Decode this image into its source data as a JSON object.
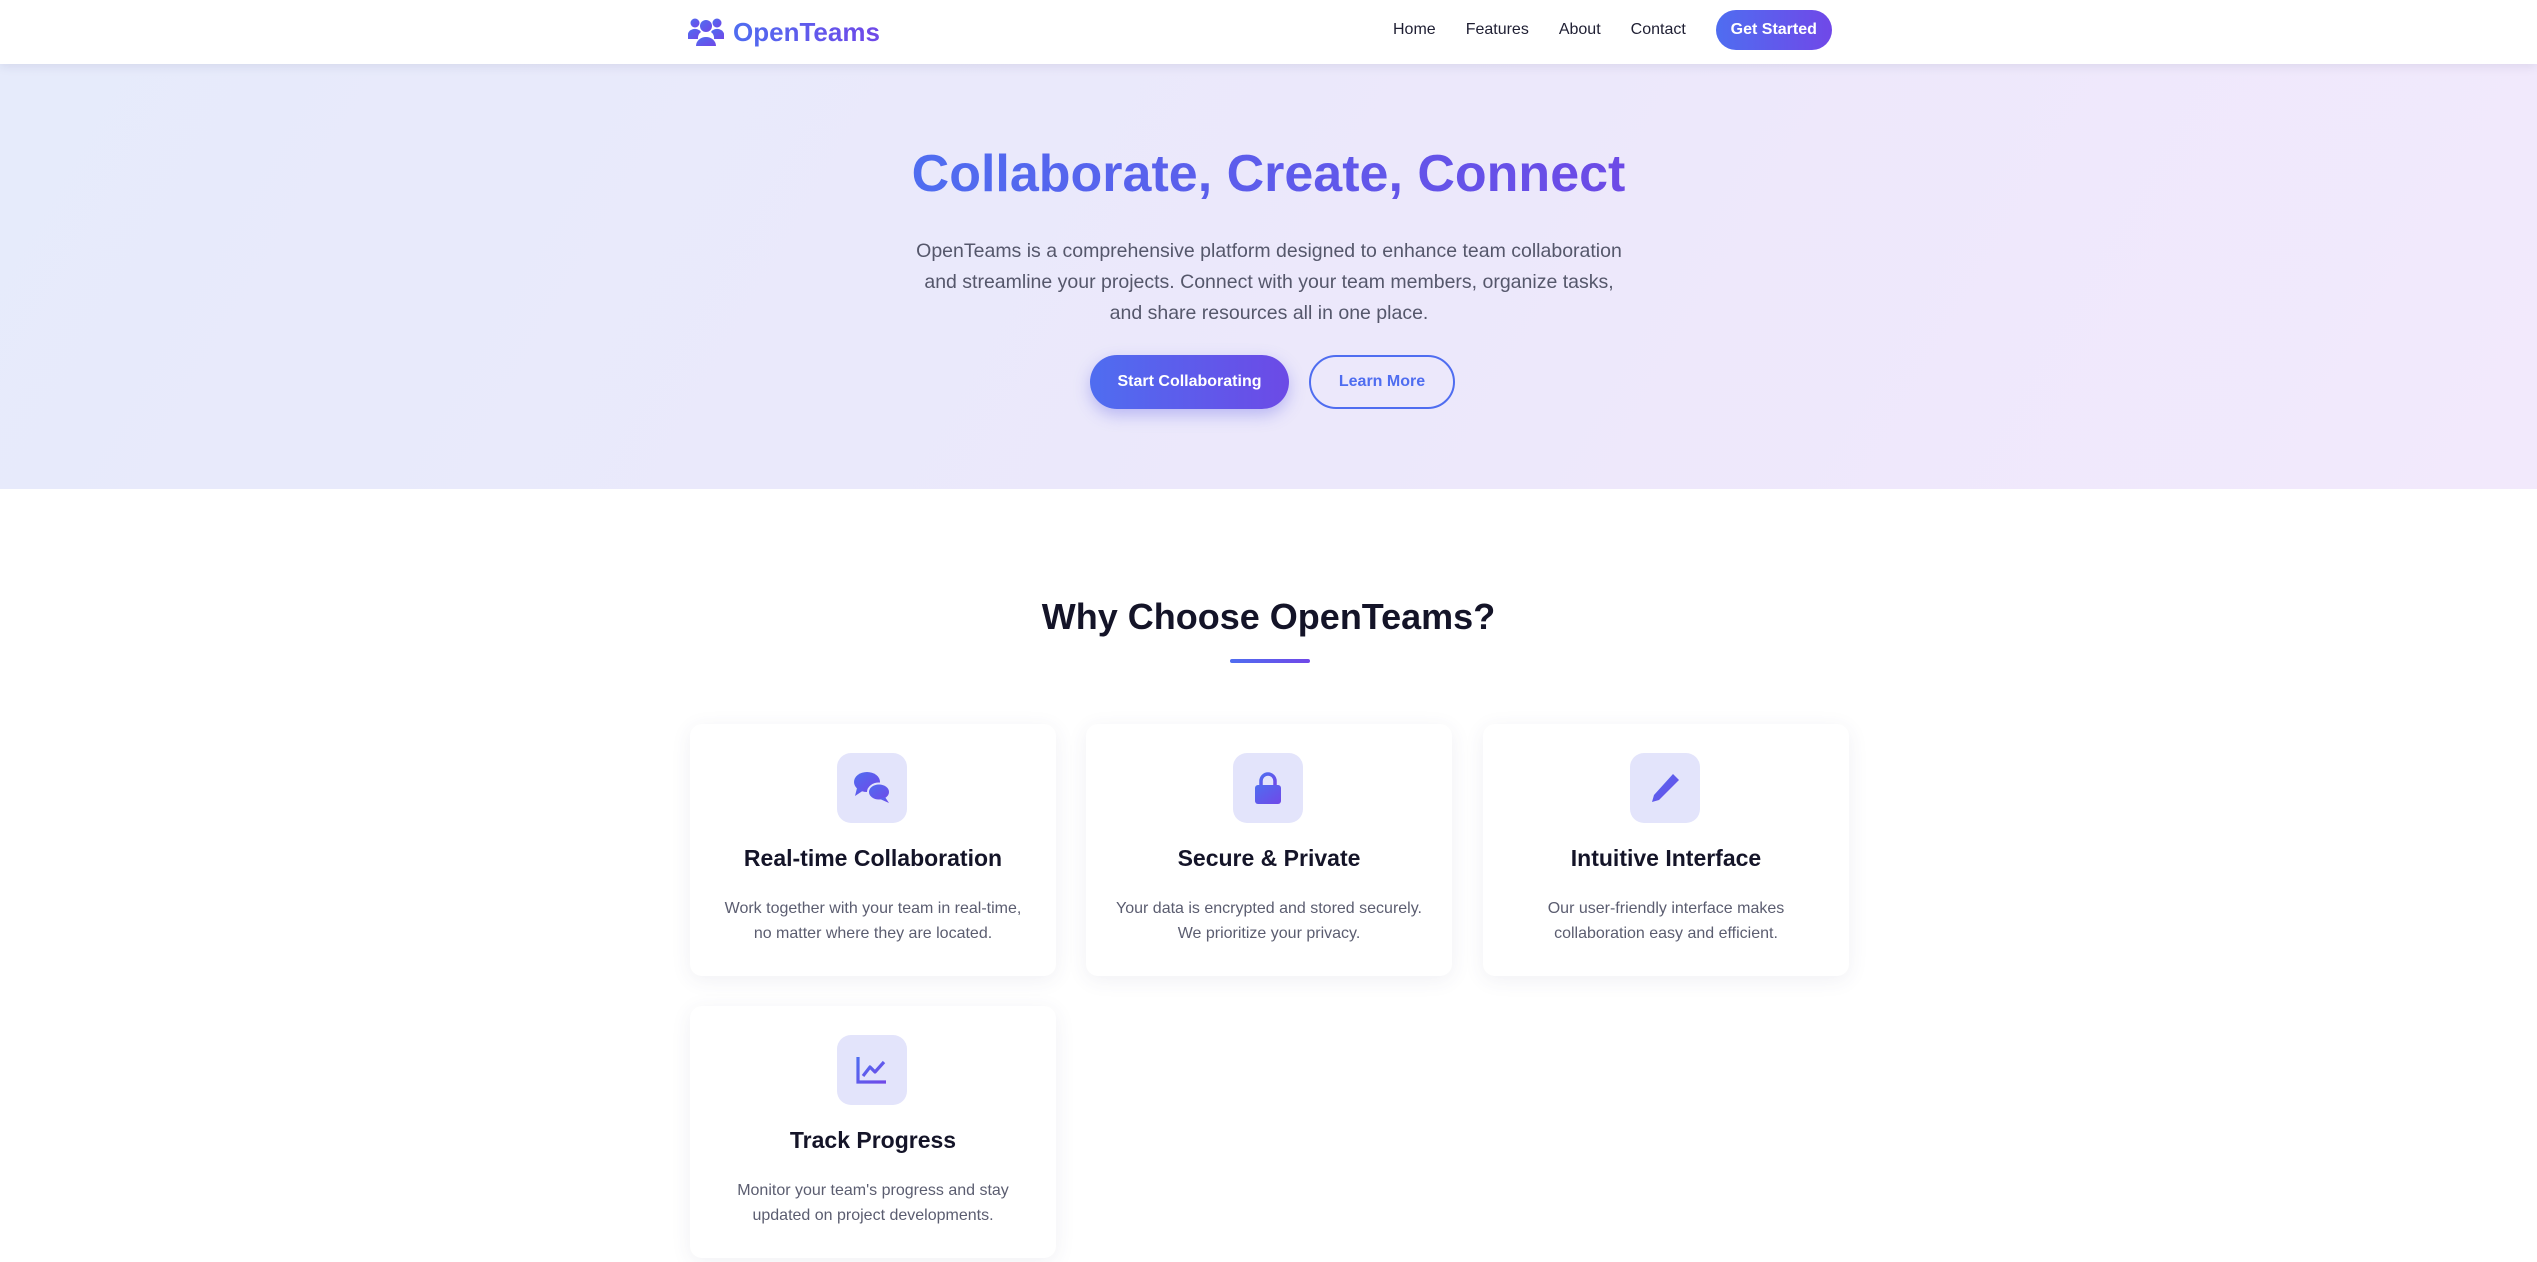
{
  "nav": {
    "brand": "OpenTeams",
    "brand_icon": "users-icon",
    "links": [
      "Home",
      "Features",
      "About",
      "Contact"
    ],
    "cta": "Get Started"
  },
  "hero": {
    "title": "Collaborate, Create, Connect",
    "description_lines": [
      "OpenTeams is a comprehensive platform designed to enhance team collaboration",
      "and streamline your projects. Connect with your team members, organize tasks,",
      "and share resources all in one place."
    ],
    "primary_button": "Start Collaborating",
    "secondary_button": "Learn More"
  },
  "features": {
    "title": "Why Choose OpenTeams?",
    "cards": [
      {
        "icon": "comments-icon",
        "title": "Real-time Collaboration",
        "desc_lines": [
          "Work together with your team in real-time,",
          "no matter where they are located."
        ]
      },
      {
        "icon": "lock-icon",
        "title": "Secure & Private",
        "desc_lines": [
          "Your data is encrypted and stored securely.",
          "We prioritize your privacy."
        ]
      },
      {
        "icon": "pen-icon",
        "title": "Intuitive Interface",
        "desc_lines": [
          "Our user-friendly interface makes",
          "collaboration easy and efficient."
        ]
      },
      {
        "icon": "chart-line-icon",
        "title": "Track Progress",
        "desc_lines": [
          "Monitor your team's progress and stay",
          "updated on project developments."
        ]
      }
    ]
  },
  "colors": {
    "brand_start": "#4f6df0",
    "brand_end": "#7048e8",
    "icon_bg": "#e3e4fb",
    "heading": "#141428",
    "body_text": "#5b5d70"
  }
}
